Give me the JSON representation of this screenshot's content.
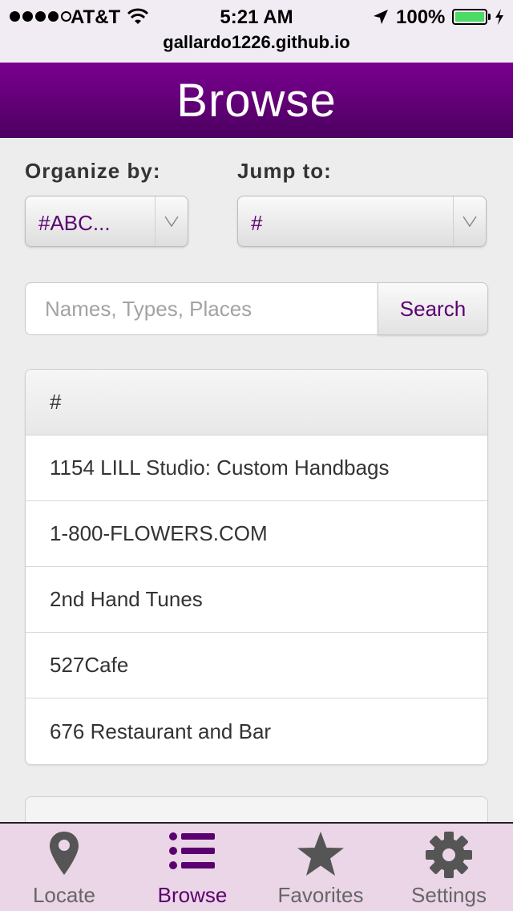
{
  "status_bar": {
    "carrier": "AT&T",
    "time": "5:21 AM",
    "battery": "100%",
    "url": "gallardo1226.github.io"
  },
  "header": {
    "title": "Browse"
  },
  "organize": {
    "label": "Organize by:",
    "value": "#ABC..."
  },
  "jump": {
    "label": "Jump to:",
    "value": "#"
  },
  "search": {
    "placeholder": "Names, Types, Places",
    "button_label": "Search"
  },
  "list": {
    "divider": "#",
    "items": [
      "1154 LILL Studio: Custom Handbags",
      "1-800-FLOWERS.COM",
      "2nd Hand Tunes",
      "527Cafe",
      "676 Restaurant and Bar"
    ]
  },
  "tabs": [
    {
      "label": "Locate",
      "icon": "map-pin-icon",
      "active": false
    },
    {
      "label": "Browse",
      "icon": "list-icon",
      "active": true
    },
    {
      "label": "Favorites",
      "icon": "star-icon",
      "active": false
    },
    {
      "label": "Settings",
      "icon": "gear-icon",
      "active": false
    }
  ],
  "colors": {
    "accent": "#5a0070",
    "header_top": "#7a0090",
    "header_bottom": "#4c0060",
    "tabbar_bg": "#ead6e6"
  }
}
